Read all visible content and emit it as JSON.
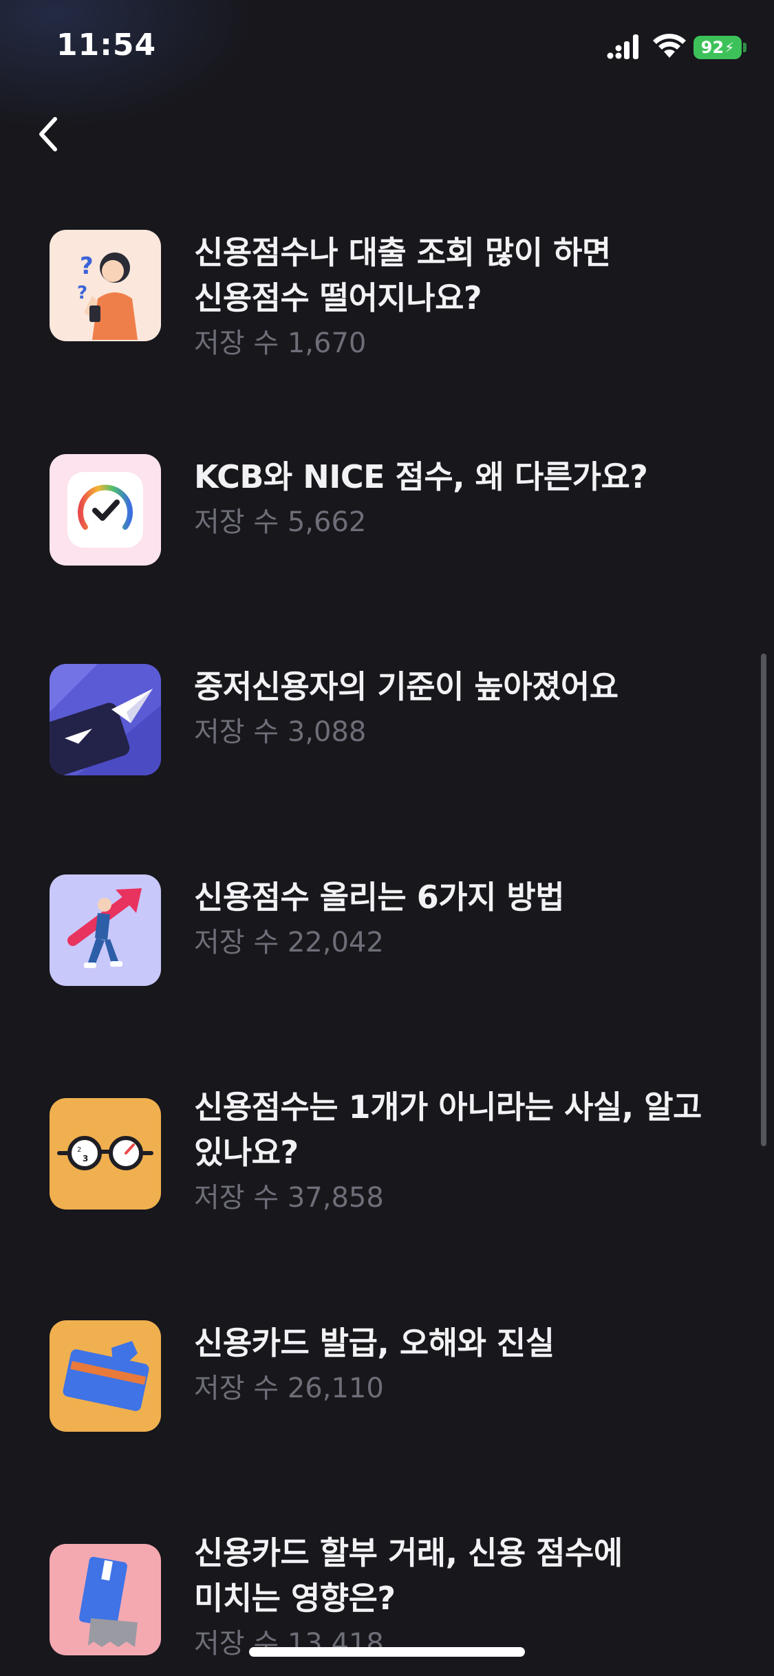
{
  "status_bar": {
    "time": "11:54",
    "battery": "92"
  },
  "nav": {
    "back_icon": "chevron-left-icon"
  },
  "articles": [
    {
      "title_lines": [
        "신용점수나 대출 조회 많이 하면",
        "신용점수 떨어지나요?"
      ],
      "saves": "저장 수 1,670",
      "thumb_bg": "#fbe7dc",
      "icon": "question-woman-illustration-icon"
    },
    {
      "title_lines": [
        "KCB와 NICE 점수, 왜 다른가요?"
      ],
      "saves": "저장 수 5,662",
      "thumb_bg": "#fde3ee",
      "icon": "score-gauge-check-icon"
    },
    {
      "title_lines": [
        "중저신용자의 기준이 높아졌어요"
      ],
      "saves": "저장 수 3,088",
      "thumb_bg": "#5b5bd6",
      "icon": "paper-plane-card-icon"
    },
    {
      "title_lines": [
        "신용점수 올리는 6가지 방법"
      ],
      "saves": "저장 수 22,042",
      "thumb_bg": "#c9c8fb",
      "icon": "person-arrow-up-icon"
    },
    {
      "title_lines": [
        "신용점수는 1개가 아니라는 사실, 알고",
        "있나요?"
      ],
      "saves": "저장 수 37,858",
      "thumb_bg": "#f0b04f",
      "icon": "two-gauges-glasses-icon"
    },
    {
      "title_lines": [
        "신용카드 발급, 오해와 진실"
      ],
      "saves": "저장 수 26,110",
      "thumb_bg": "#f0b04f",
      "icon": "credit-card-hand-icon"
    },
    {
      "title_lines": [
        "신용카드 할부 거래, 신용 점수에",
        "미치는 영향은?"
      ],
      "saves": "저장 수 13,418",
      "thumb_bg": "#f4a9b1",
      "icon": "card-receipt-icon"
    }
  ]
}
